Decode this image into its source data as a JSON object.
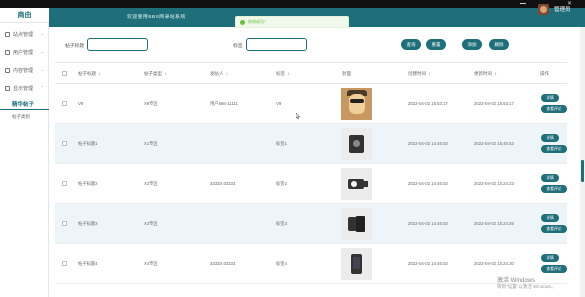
{
  "brand": "商由",
  "header": {
    "title": "欢迎使用BBS网录站系统",
    "user": "管理员"
  },
  "toast": {
    "text": "修改成功！"
  },
  "sidebar": {
    "items": [
      {
        "label": "站点管理",
        "icon": "home-icon"
      },
      {
        "label": "用户管理",
        "icon": "user-icon"
      },
      {
        "label": "内容管理",
        "icon": "file-icon"
      },
      {
        "label": "显示管理",
        "icon": "grid-icon"
      }
    ],
    "active_sub": "精华帖子",
    "sub_item": "帖子类别"
  },
  "search": {
    "field1_label": "帖子标题",
    "field1_value": "",
    "field2_label": "标签",
    "field2_value": "",
    "query_button": "查询",
    "reset_button": "重置",
    "add_button": "添加",
    "delete_button": "删除"
  },
  "table": {
    "columns": [
      "帖子标题",
      "帖子类型",
      "发帖人",
      "标签",
      "封面",
      "创建时间",
      "更新时间",
      "操作"
    ],
    "detail_label": "详情",
    "comments_label": "查看评论",
    "rows": [
      {
        "title": "V9",
        "type": "X9专区",
        "author": "用户666-11111",
        "tag": "V9",
        "cover": "dog-photo",
        "created": "2022-04-02 15:53:17",
        "updated": "2022-04-02 15:53:17"
      },
      {
        "title": "帖子标题1",
        "type": "X1专区",
        "author": "",
        "tag": "标签1",
        "cover": "camera-lens",
        "created": "2022-04-02 14:46:02",
        "updated": "2022-04-02 15:45:53"
      },
      {
        "title": "帖子标题2",
        "type": "X2专区",
        "author": "33333-33333",
        "tag": "标签2",
        "cover": "video-camera",
        "created": "2022-04-02 14:46:02",
        "updated": "2022-04-02 15:24:23"
      },
      {
        "title": "帖子标题3",
        "type": "X3专区",
        "author": "",
        "tag": "标签3",
        "cover": "phones",
        "created": "2022-04-02 14:46:02",
        "updated": "2022-04-02 15:24:26"
      },
      {
        "title": "帖子标题4",
        "type": "X4专区",
        "author": "33333-33333",
        "tag": "标签4",
        "cover": "phone",
        "created": "2022-04-02 14:46:02",
        "updated": "2022-04-02 15:24:30"
      }
    ]
  },
  "watermark": {
    "line1": "激活 Windows",
    "line2": "转到\"设置\"以激活 Windows。"
  },
  "colors": {
    "accent": "#1f6f7a",
    "row_alt": "#eef5f9",
    "toast_green": "#67c23a"
  }
}
